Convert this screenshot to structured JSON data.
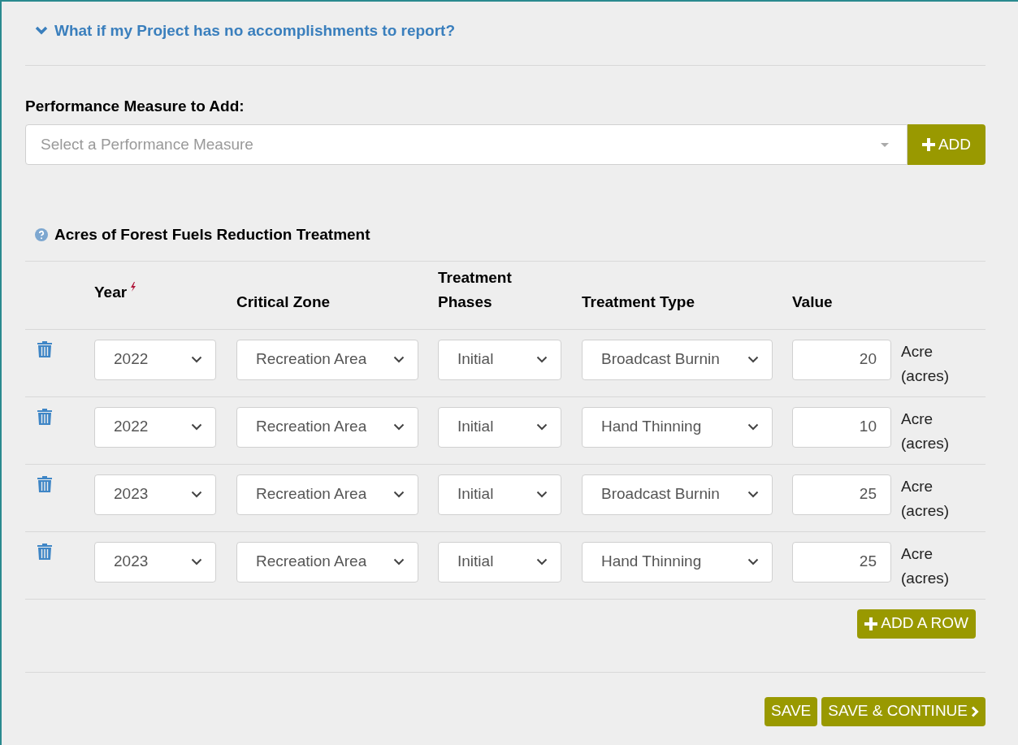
{
  "faq_toggle": {
    "label": "What if my Project has no accomplishments to report?",
    "expanded": false
  },
  "add_measure": {
    "label": "Performance Measure to Add:",
    "placeholder": "Select a Performance Measure",
    "button": "ADD"
  },
  "measure": {
    "title": "Acres of Forest Fuels Reduction Treatment",
    "columns": [
      {
        "label": "Year",
        "required": true
      },
      {
        "label": "Critical Zone",
        "required": false
      },
      {
        "label": "Treatment Phases",
        "required": false
      },
      {
        "label": "Treatment Type",
        "required": false
      },
      {
        "label": "Value",
        "required": false
      }
    ],
    "rows": [
      {
        "year": "2022",
        "zone": "Recreation Area",
        "phase": "Initial",
        "type": "Broadcast Burnin",
        "value": "20",
        "unit": "Acre (acres)"
      },
      {
        "year": "2022",
        "zone": "Recreation Area",
        "phase": "Initial",
        "type": "Hand Thinning",
        "value": "10",
        "unit": "Acre (acres)"
      },
      {
        "year": "2023",
        "zone": "Recreation Area",
        "phase": "Initial",
        "type": "Broadcast Burnin",
        "value": "25",
        "unit": "Acre (acres)"
      },
      {
        "year": "2023",
        "zone": "Recreation Area",
        "phase": "Initial",
        "type": "Hand Thinning",
        "value": "25",
        "unit": "Acre (acres)"
      }
    ],
    "add_row": "ADD A ROW"
  },
  "buttons": [
    "SAVE",
    "SAVE & CONTINUE"
  ]
}
